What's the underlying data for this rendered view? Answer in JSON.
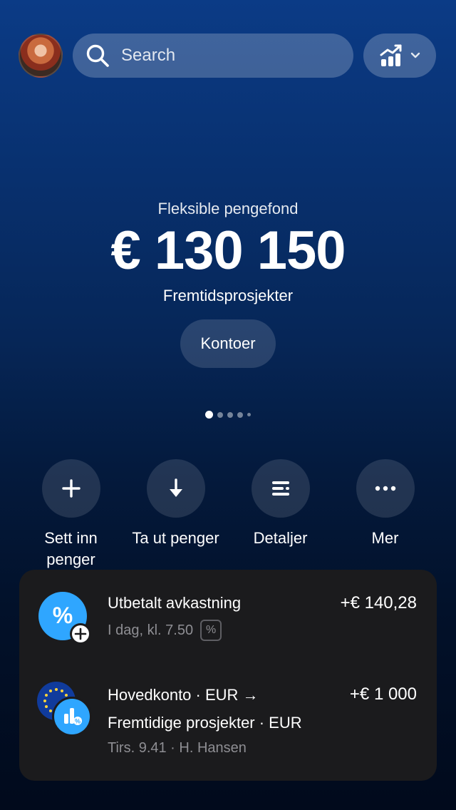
{
  "search": {
    "placeholder": "Search"
  },
  "hero": {
    "subtitle": "Fleksible pengefond",
    "amount": "€ 130 150",
    "account_name": "Fremtidsprosjekter",
    "accounts_button": "Kontoer"
  },
  "pager": {
    "count": 5,
    "active_index": 0
  },
  "actions": [
    {
      "label": "Sett inn penger",
      "icon": "plus-icon"
    },
    {
      "label": "Ta ut penger",
      "icon": "arrow-down-icon"
    },
    {
      "label": "Detaljer",
      "icon": "details-icon"
    },
    {
      "label": "Mer",
      "icon": "more-icon"
    }
  ],
  "transactions": [
    {
      "title": "Utbetalt avkastning",
      "amount": "+€ 140,28",
      "meta": "I dag, kl. 7.50",
      "icon": "percent-icon"
    },
    {
      "title_line1": "Hovedkonto · EUR →",
      "title_line2": "Fremtidige prosjekter · EUR",
      "amount": "+€ 1 000",
      "meta": "Tirs. 9.41 · H. Hansen",
      "icon": "eu-flag-icon"
    }
  ],
  "colors": {
    "accent_blue": "#2fa6ff",
    "panel": "#1b1b1d",
    "muted_text": "#8e8e93"
  }
}
